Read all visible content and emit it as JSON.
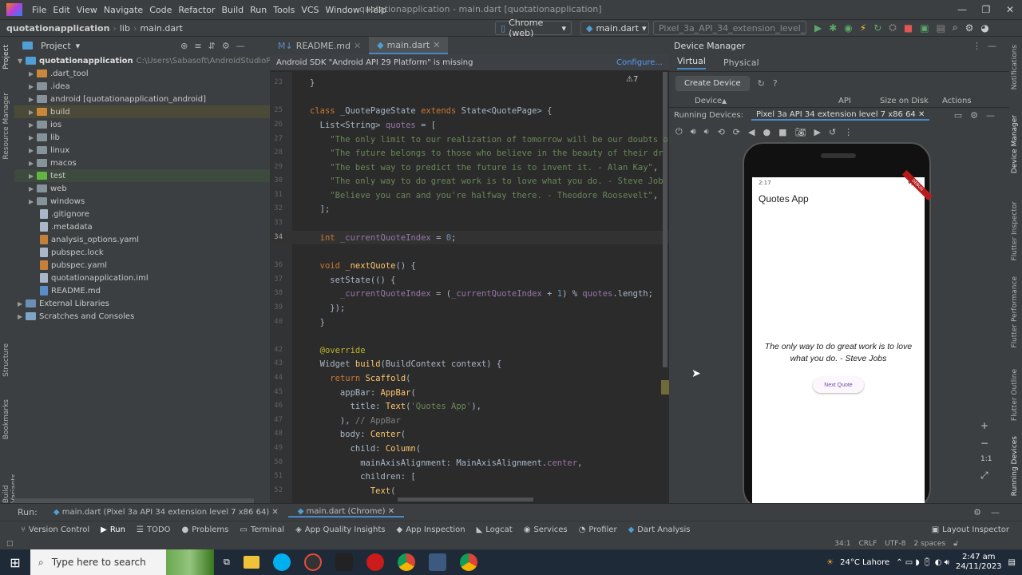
{
  "menu": {
    "items": [
      "File",
      "Edit",
      "View",
      "Navigate",
      "Code",
      "Refactor",
      "Build",
      "Run",
      "Tools",
      "VCS",
      "Window",
      "Help"
    ]
  },
  "window": {
    "title": "quotationapplication - main.dart [quotationapplication]"
  },
  "nav": {
    "project": "quotationapplication",
    "lib": "lib",
    "file": "main.dart",
    "device_combo": "Chrome (web)",
    "run_config": "main.dart",
    "avd_combo": "Pixel_3a_API_34_extension_level_7_x86"
  },
  "project_panel": {
    "title": "Project",
    "root": "quotationapplication",
    "root_path": "C:\\Users\\Sabasoft\\AndroidStudioProjects\\quo",
    "items": [
      {
        "label": ".dart_tool"
      },
      {
        "label": ".idea"
      },
      {
        "label": "android [quotationapplication_android]"
      },
      {
        "label": "build"
      },
      {
        "label": "ios"
      },
      {
        "label": "lib"
      },
      {
        "label": "linux"
      },
      {
        "label": "macos"
      },
      {
        "label": "test"
      },
      {
        "label": "web"
      },
      {
        "label": "windows"
      },
      {
        "label": ".gitignore"
      },
      {
        "label": ".metadata"
      },
      {
        "label": "analysis_options.yaml"
      },
      {
        "label": "pubspec.lock"
      },
      {
        "label": "pubspec.yaml"
      },
      {
        "label": "quotationapplication.iml"
      },
      {
        "label": "README.md"
      },
      {
        "label": "External Libraries"
      },
      {
        "label": "Scratches and Consoles"
      }
    ]
  },
  "left_strip": {
    "project": "Project",
    "resource": "Resource Manager",
    "structure": "Structure",
    "bookmarks": "Bookmarks",
    "build_variants": "Build Variants"
  },
  "editor": {
    "tabs": [
      {
        "label": "README.md"
      },
      {
        "label": "main.dart"
      }
    ],
    "banner": "Android SDK \"Android API 29 Platform\" is missing",
    "banner_link": "Configure...",
    "warnings": "⚠7",
    "line_numbers": [
      "23",
      "",
      "25",
      "26",
      "27",
      "28",
      "29",
      "30",
      "31",
      "32",
      "33",
      "34",
      "35",
      "36",
      "37",
      "38",
      "39",
      "40",
      "41",
      "42",
      "43",
      "44",
      "45",
      "46",
      "47",
      "48",
      "49",
      "50",
      "51",
      "52"
    ]
  },
  "device_manager": {
    "title": "Device Manager",
    "tab_virtual": "Virtual",
    "tab_physical": "Physical",
    "create": "Create Device",
    "col_device": "Device",
    "col_api": "API",
    "col_size": "Size on Disk",
    "col_actions": "Actions",
    "running_label": "Running Devices:",
    "running_tab": "Pixel 3a API 34 extension level 7 x86 64"
  },
  "phone": {
    "time": "2:17",
    "app_title": "Quotes App",
    "quote": "The only way to do great work is to love what you do. - Steve Jobs",
    "button": "Next Quote",
    "debug": "DEBUG"
  },
  "right_strip": {
    "notifications": "Notifications",
    "device_manager": "Device Manager",
    "flutter_inspector": "Flutter Inspector",
    "flutter_performance": "Flutter Performance",
    "flutter_outline": "Flutter Outline",
    "running_devices": "Running Devices"
  },
  "runbar": {
    "label": "Run:",
    "tab1": "main.dart (Pixel 3a API 34 extension level 7 x86 64)",
    "tab2": "main.dart (Chrome)"
  },
  "toolwindows": [
    "Version Control",
    "Run",
    "TODO",
    "Problems",
    "Terminal",
    "App Quality Insights",
    "App Inspection",
    "Logcat",
    "Services",
    "Profiler",
    "Dart Analysis"
  ],
  "layout_inspector": "Layout Inspector",
  "status": {
    "pos": "34:1",
    "crlf": "CRLF",
    "enc": "UTF-8",
    "indent": "2 spaces"
  },
  "taskbar": {
    "search": "Type here to search",
    "weather": "24°C Lahore",
    "time": "2:47 am",
    "date": "24/11/2023"
  },
  "colors": {
    "accent": "#4a88c7",
    "bg": "#2b2b2b",
    "panel": "#3c3f41"
  }
}
